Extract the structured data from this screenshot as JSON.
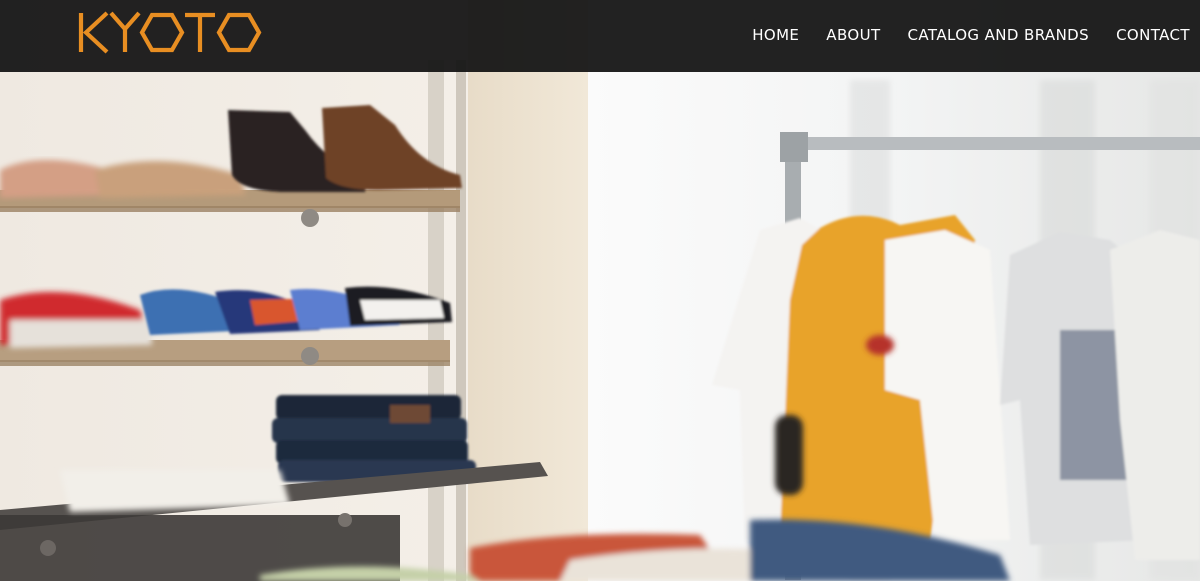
{
  "brand": {
    "name": "KYOTO",
    "color": "#e88e22"
  },
  "nav": {
    "items": [
      {
        "label": "HOME"
      },
      {
        "label": "ABOUT"
      },
      {
        "label": "CATALOG AND BRANDS"
      },
      {
        "label": "CONTACT"
      }
    ]
  },
  "hero": {
    "image": "clothing-store-interior-photo"
  }
}
